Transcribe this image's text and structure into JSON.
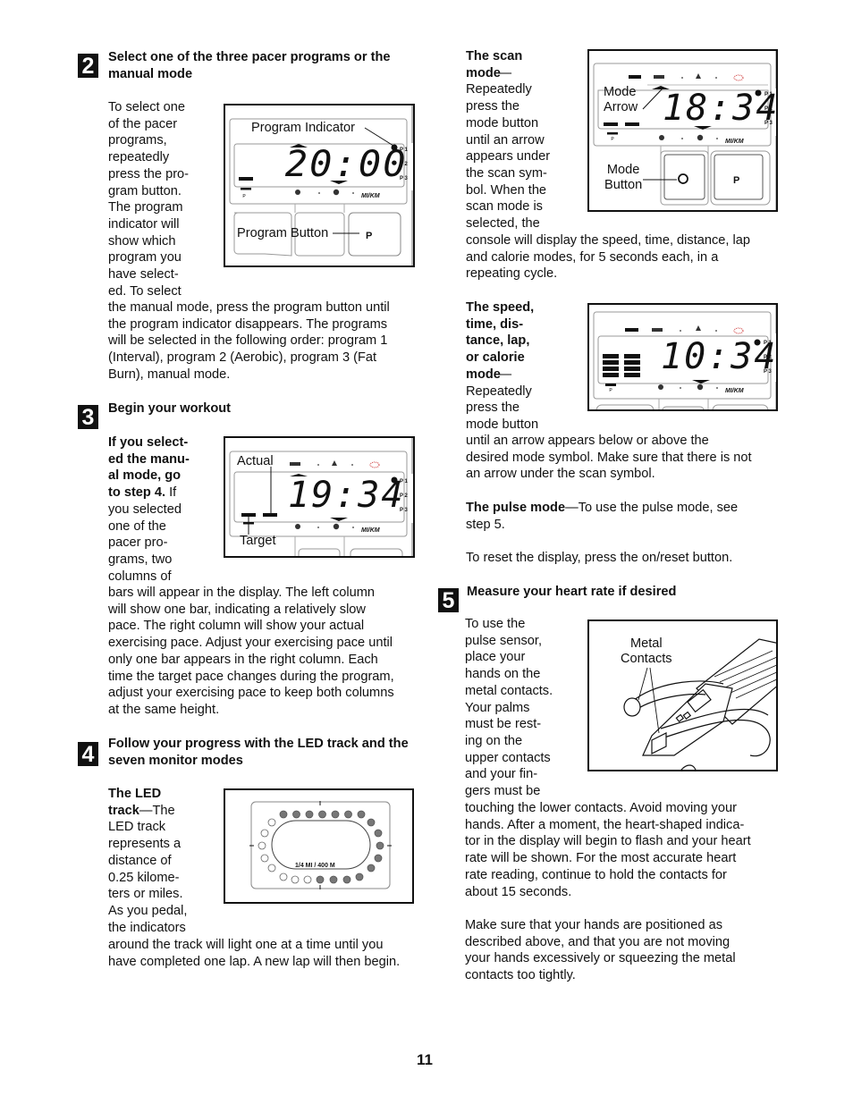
{
  "page_number": "11",
  "step2": {
    "number": "2",
    "heading": "Select one of the three pacer programs or the manual mode",
    "text_narrow": "To select one\nof the pacer\nprograms,\nrepeatedly\npress the pro-\ngram button.\nThe program\nindicator will\nshow which\nprogram you\nhave select-\ned. To select",
    "text_wide": "the manual mode, press the program button until\nthe program indicator disappears. The programs\nwill be selected in the following order: program 1\n(Interval), program 2 (Aerobic), program 3 (Fat\nBurn), manual mode.",
    "figure": {
      "display": "20:00",
      "label_indicator": "Program Indicator",
      "label_button": "Program Button",
      "button_glyph": "P",
      "program_labels": [
        "P 1",
        "P 2",
        "P 3"
      ],
      "units": "MI/KM"
    }
  },
  "step3": {
    "number": "3",
    "heading": "Begin your workout",
    "bold_lead": "If you select-\ned the manu-\nal mode, go\nto step 4.",
    "text_narrow": " If\nyou selected\none of the\npacer pro-\ngrams, two\ncolumns of",
    "text_wide": "bars will appear in the display. The left column\nwill show one bar, indicating a relatively slow\npace. The right column will show your actual\nexercising pace. Adjust your exercising pace until\nonly one bar appears in the right column. Each\ntime the target pace changes during the program,\nadjust your exercising pace to keep both columns\nat the same height.",
    "figure": {
      "display": "19:34",
      "label_actual": "Actual",
      "label_target": "Target",
      "program_labels": [
        "P 1",
        "P 2",
        "P 3"
      ],
      "units": "MI/KM"
    }
  },
  "step4": {
    "number": "4",
    "heading": "Follow your progress with the LED track and the seven monitor modes",
    "led_title": "The LED\ntrack",
    "led_text_narrow": "—The\nLED track\nrepresents a\ndistance of\n0.25 kilome-\nters or miles.\nAs you pedal,\nthe indicators",
    "led_text_wide": "around the track will light one at a time until you\nhave completed one lap. A new lap will then begin.",
    "figure": {
      "track_label": "1/4 MI / 400 M",
      "lit_count": 16,
      "total_count": 24
    }
  },
  "scan": {
    "title": "The scan\nmode",
    "text_narrow": "—\nRepeatedly\npress the\nmode button\nuntil an arrow\nappears under\nthe scan sym-\nbol. When the\nscan mode is\nselected, the",
    "text_wide": "console will display the speed, time, distance, lap\nand calorie modes, for 5 seconds each, in a\nrepeating cycle.",
    "figure": {
      "display": "18:34",
      "label_arrow": "Mode\nArrow",
      "label_button": "Mode\nButton",
      "button_glyph": "P",
      "program_labels": [
        "P 1",
        "P 2",
        "P 3"
      ],
      "units": "MI/KM"
    }
  },
  "modes": {
    "title": "The speed,\ntime, dis-\ntance, lap,\nor calorie\nmode",
    "text_narrow": "—\nRepeatedly\npress the\nmode button",
    "text_wide": "until an arrow appears below or above the\ndesired mode symbol. Make sure that there is not\nan arrow under the scan symbol.",
    "figure": {
      "display": "10:34",
      "program_labels": [
        "P 1",
        "P 2",
        "P 3"
      ],
      "units": "MI/KM"
    }
  },
  "pulse": {
    "title": "The pulse mode",
    "text": "—To use the pulse mode, see\nstep 5."
  },
  "reset_text": "To reset the display, press the on/reset button.",
  "step5": {
    "number": "5",
    "heading": "Measure your heart rate if desired",
    "text_narrow": "To use the\npulse sensor,\nplace your\nhands on the\nmetal contacts.\nYour palms\nmust be rest-\ning on the\nupper contacts\nand your fin-\ngers must be",
    "text_wide": "touching the lower contacts. Avoid moving your\nhands. After a moment, the heart-shaped indica-\ntor in the display will begin to flash and your heart\nrate will be shown. For the most accurate heart\nrate reading, continue to hold the contacts for\nabout 15 seconds.",
    "text_final": "Make sure that your hands are positioned as\ndescribed above, and that you are not moving\nyour hands excessively or squeezing the metal\ncontacts too tightly.",
    "figure": {
      "label_contacts": "Metal\nContacts"
    }
  }
}
